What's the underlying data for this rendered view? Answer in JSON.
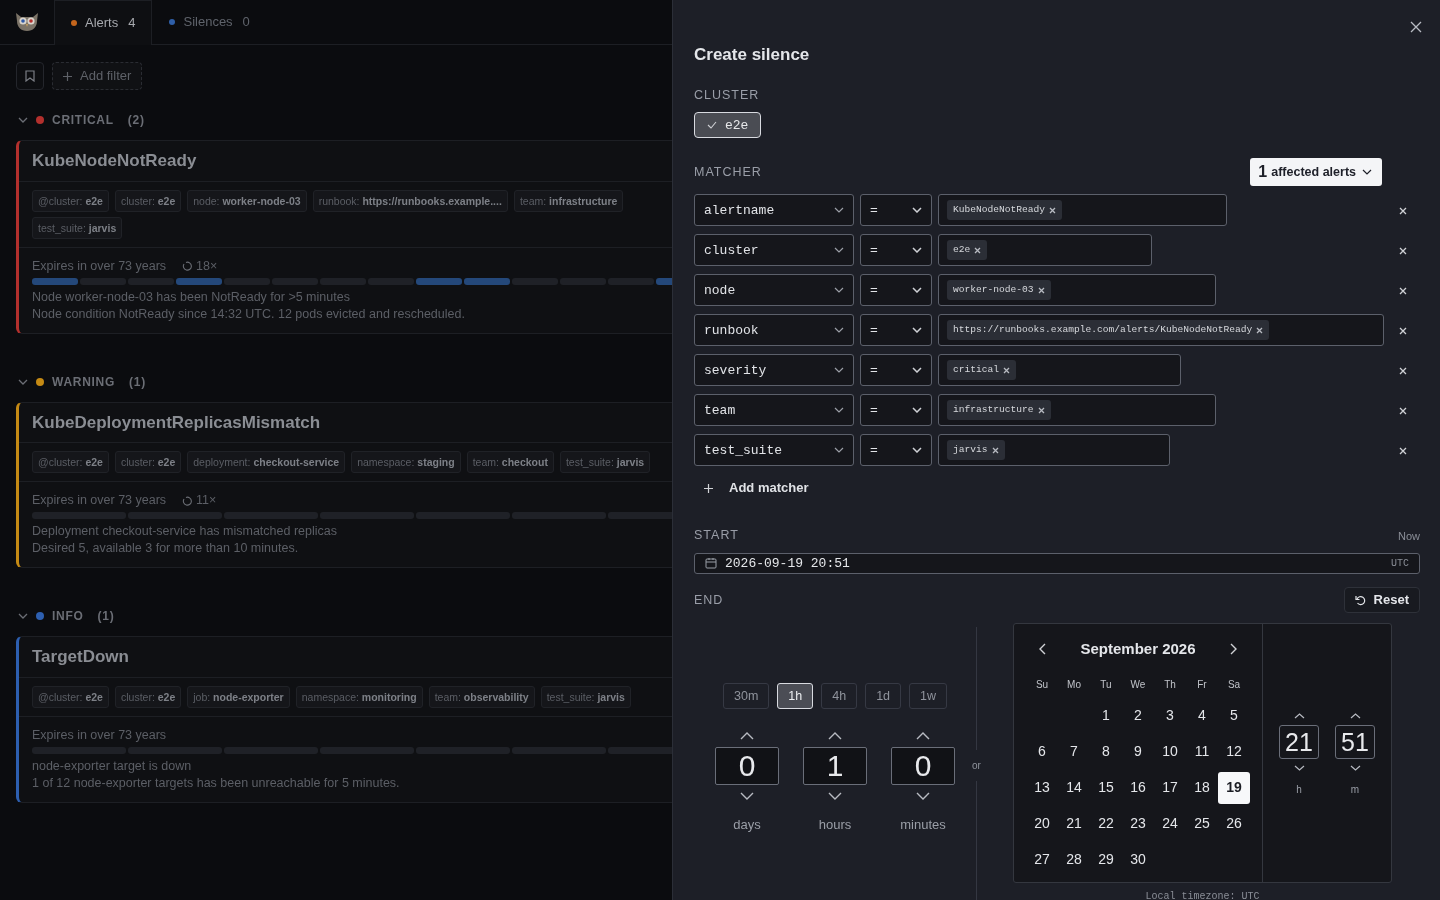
{
  "app": {
    "tabs": [
      {
        "label": "Alerts",
        "count": "4",
        "color": "#c4651c",
        "selected": true
      },
      {
        "label": "Silences",
        "count": "0",
        "color": "#2f5fa8",
        "selected": false
      }
    ],
    "add_filter": "Add filter"
  },
  "groups": [
    {
      "name": "CRITICAL",
      "count": "(2)",
      "color": "#b3302d",
      "expanded": true,
      "alerts": [
        {
          "title": "KubeNodeNotReady",
          "labels": [
            {
              "key": "@cluster:",
              "value": "e2e"
            },
            {
              "key": "cluster:",
              "value": "e2e"
            },
            {
              "key": "node:",
              "value": "worker-node-03"
            },
            {
              "key": "runbook:",
              "value": "https://runbooks.example...."
            },
            {
              "key": "team:",
              "value": "infrastructure"
            },
            {
              "key": "test_suite:",
              "value": "jarvis"
            }
          ],
          "expires": "Expires in over 73 years",
          "repeat": "18×",
          "activity": [
            true,
            false,
            false,
            true,
            false,
            false,
            false,
            false,
            true,
            true,
            false,
            false,
            false,
            true
          ],
          "summary": "Node worker-node-03 has been NotReady for >5 minutes",
          "details": "Node condition NotReady since 14:32 UTC. 12 pods evicted and rescheduled."
        }
      ]
    },
    {
      "name": "WARNING",
      "count": "(1)",
      "color": "#c58a14",
      "expanded": true,
      "alerts": [
        {
          "title": "KubeDeploymentReplicasMismatch",
          "labels": [
            {
              "key": "@cluster:",
              "value": "e2e"
            },
            {
              "key": "cluster:",
              "value": "e2e"
            },
            {
              "key": "deployment:",
              "value": "checkout-service"
            },
            {
              "key": "namespace:",
              "value": "staging"
            },
            {
              "key": "team:",
              "value": "checkout"
            },
            {
              "key": "test_suite:",
              "value": "jarvis"
            }
          ],
          "expires": "Expires in over 73 years",
          "repeat": "11×",
          "activity": [
            false,
            false,
            false,
            false,
            false,
            false,
            false
          ],
          "summary": "Deployment checkout-service has mismatched replicas",
          "details": "Desired 5, available 3 for more than 10 minutes."
        }
      ]
    },
    {
      "name": "INFO",
      "count": "(1)",
      "color": "#2d5fb0",
      "expanded": true,
      "alerts": [
        {
          "title": "TargetDown",
          "labels": [
            {
              "key": "@cluster:",
              "value": "e2e"
            },
            {
              "key": "cluster:",
              "value": "e2e"
            },
            {
              "key": "job:",
              "value": "node-exporter"
            },
            {
              "key": "namespace:",
              "value": "monitoring"
            },
            {
              "key": "team:",
              "value": "observability"
            },
            {
              "key": "test_suite:",
              "value": "jarvis"
            }
          ],
          "expires": "Expires in over 73 years",
          "activity": [
            false,
            false,
            false,
            false,
            false,
            false,
            false
          ],
          "summary": "node-exporter target is down",
          "details": "1 of 12 node-exporter targets has been unreachable for 5 minutes."
        }
      ]
    }
  ],
  "silence_panel": {
    "title": "Create silence",
    "cluster": {
      "label": "CLUSTER",
      "options": [
        {
          "label": "e2e",
          "selected": true
        }
      ]
    },
    "matcher": {
      "label": "MATCHER",
      "affected_count": "1",
      "affected_label": "affected alerts",
      "rows": [
        {
          "name": "alertname",
          "operator": "=",
          "values": [
            "KubeNodeNotReady"
          ]
        },
        {
          "name": "cluster",
          "operator": "=",
          "values": [
            "e2e"
          ]
        },
        {
          "name": "node",
          "operator": "=",
          "values": [
            "worker-node-03"
          ]
        },
        {
          "name": "runbook",
          "operator": "=",
          "values": [
            "https://runbooks.example.com/alerts/KubeNodeNotReady"
          ]
        },
        {
          "name": "severity",
          "operator": "=",
          "values": [
            "critical"
          ]
        },
        {
          "name": "team",
          "operator": "=",
          "values": [
            "infrastructure"
          ]
        },
        {
          "name": "test_suite",
          "operator": "=",
          "values": [
            "jarvis"
          ]
        }
      ],
      "add": "Add matcher"
    },
    "start": {
      "label": "START",
      "now": "Now",
      "value": "2026-09-19 20:51",
      "tz": "UTC"
    },
    "end": {
      "label": "END",
      "reset": "Reset",
      "presets": [
        {
          "label": "30m",
          "selected": false
        },
        {
          "label": "1h",
          "selected": true
        },
        {
          "label": "4h",
          "selected": false
        },
        {
          "label": "1d",
          "selected": false
        },
        {
          "label": "1w",
          "selected": false
        }
      ],
      "spinners": [
        {
          "value": "0",
          "unit": "days"
        },
        {
          "value": "1",
          "unit": "hours"
        },
        {
          "value": "0",
          "unit": "minutes"
        }
      ],
      "or": "or",
      "calendar": {
        "month": "September 2026",
        "weekdays": [
          "Su",
          "Mo",
          "Tu",
          "We",
          "Th",
          "Fr",
          "Sa"
        ],
        "weeks": [
          [
            {
              "day": "1",
              "selected": false
            },
            {
              "day": "2",
              "selected": false
            },
            {
              "day": "3",
              "selected": false
            },
            {
              "day": "4",
              "selected": false
            },
            {
              "day": "5",
              "selected": false
            }
          ],
          [
            {
              "day": "6",
              "selected": false
            },
            {
              "day": "7",
              "selected": false
            },
            {
              "day": "8",
              "selected": false
            },
            {
              "day": "9",
              "selected": false
            },
            {
              "day": "10",
              "selected": false
            },
            {
              "day": "11",
              "selected": false
            },
            {
              "day": "12",
              "selected": false
            }
          ],
          [
            {
              "day": "13",
              "selected": false
            },
            {
              "day": "14",
              "selected": false
            },
            {
              "day": "15",
              "selected": false
            },
            {
              "day": "16",
              "selected": false
            },
            {
              "day": "17",
              "selected": false
            },
            {
              "day": "18",
              "selected": false
            },
            {
              "day": "19",
              "selected": true
            }
          ],
          [
            {
              "day": "20",
              "selected": false
            },
            {
              "day": "21",
              "selected": false
            },
            {
              "day": "22",
              "selected": false
            },
            {
              "day": "23",
              "selected": false
            },
            {
              "day": "24",
              "selected": false
            },
            {
              "day": "25",
              "selected": false
            },
            {
              "day": "26",
              "selected": false
            }
          ],
          [
            {
              "day": "27",
              "selected": false
            },
            {
              "day": "28",
              "selected": false
            },
            {
              "day": "29",
              "selected": false
            },
            {
              "day": "30",
              "selected": false
            }
          ]
        ]
      },
      "time": [
        {
          "value": "21",
          "unit": "h"
        },
        {
          "value": "51",
          "unit": "m"
        }
      ],
      "timezone": "Local timezone: UTC"
    }
  }
}
